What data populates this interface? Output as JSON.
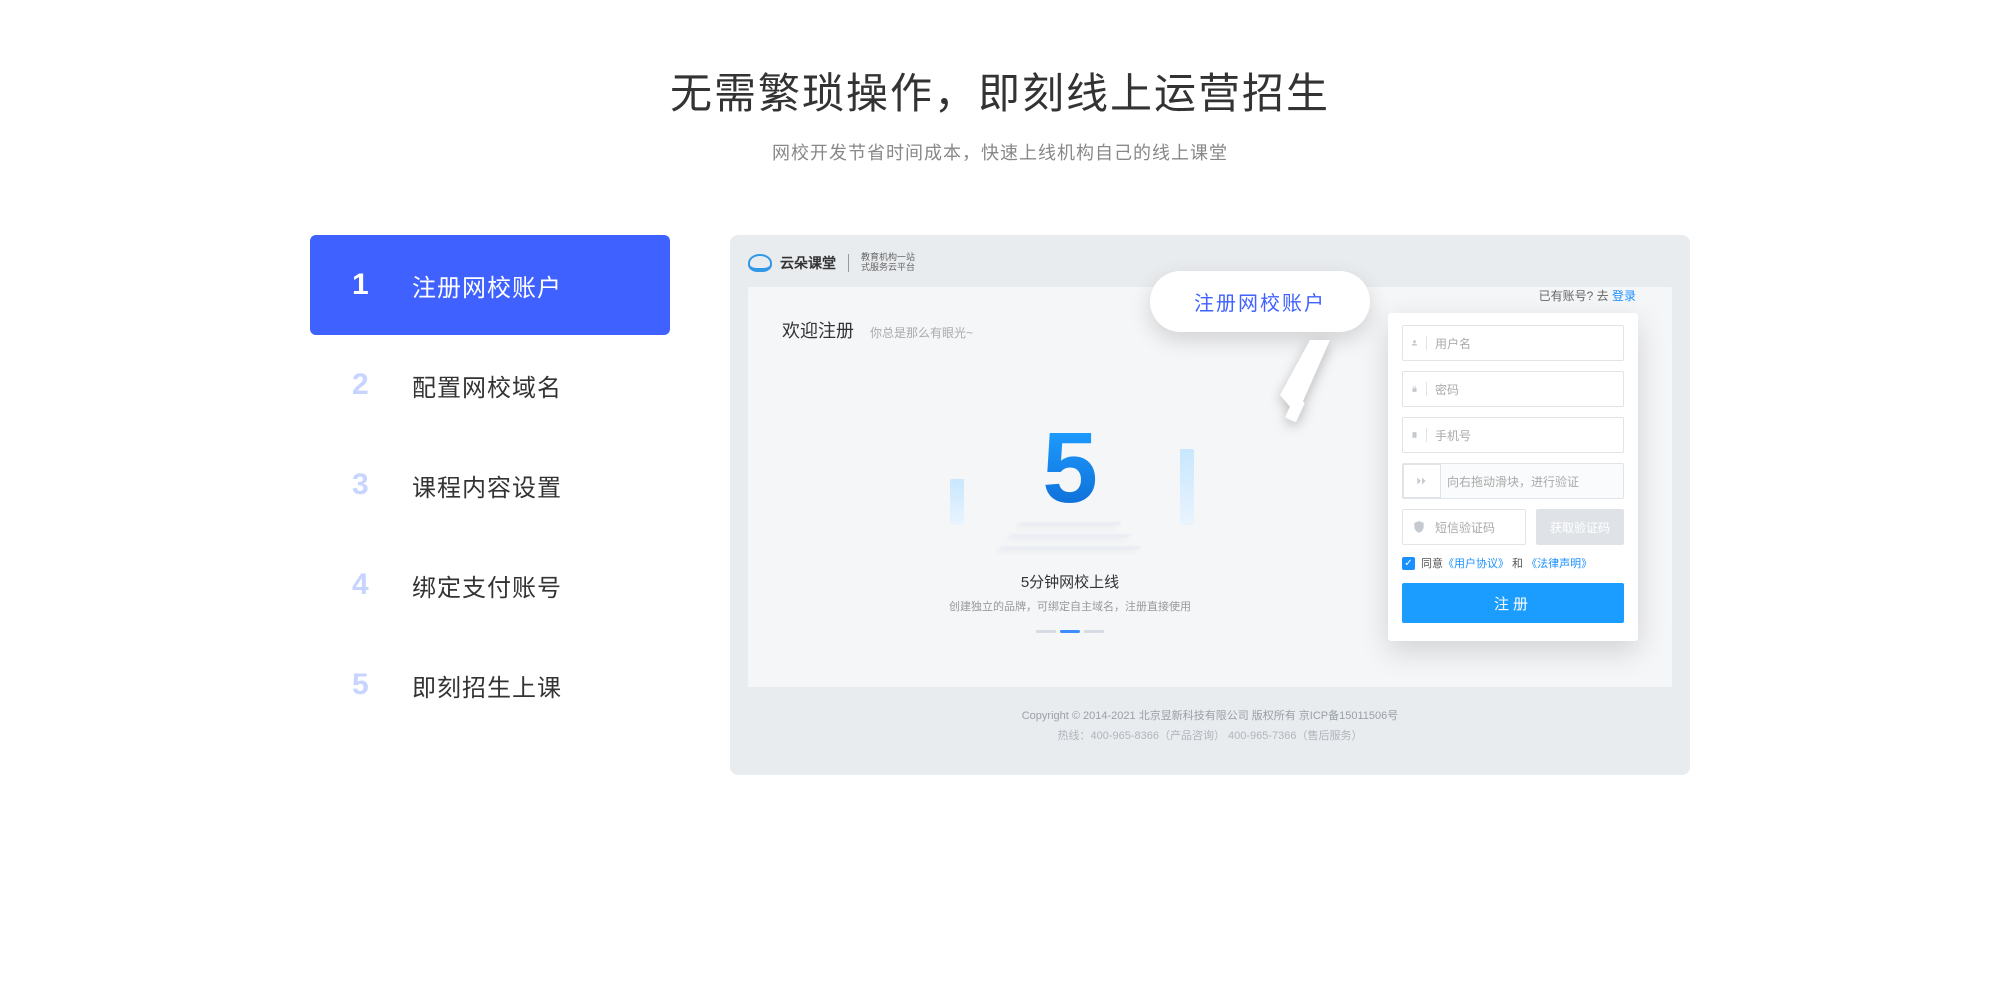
{
  "headline": {
    "title": "无需繁琐操作，即刻线上运营招生",
    "subtitle": "网校开发节省时间成本，快速上线机构自己的线上课堂"
  },
  "steps": [
    {
      "num": "1",
      "label": "注册网校账户",
      "active": true
    },
    {
      "num": "2",
      "label": "配置网校域名",
      "active": false
    },
    {
      "num": "3",
      "label": "课程内容设置",
      "active": false
    },
    {
      "num": "4",
      "label": "绑定支付账号",
      "active": false
    },
    {
      "num": "5",
      "label": "即刻招生上课",
      "active": false
    }
  ],
  "mock": {
    "brand": {
      "name": "云朵课堂",
      "sub1": "教育机构一站",
      "sub2": "式服务云平台"
    },
    "welcome_title": "欢迎注册",
    "welcome_sub": "你总是那么有眼光~",
    "center_big": "5",
    "center_line1": "5分钟网校上线",
    "center_line2": "创建独立的品牌，可绑定自主域名，注册直接使用",
    "login_hint_pre": "已有账号? 去 ",
    "login_hint_link": "登录",
    "fields": {
      "username": "用户名",
      "password": "密码",
      "phone": "手机号",
      "slider": "向右拖动滑块，进行验证",
      "smscode": "短信验证码",
      "getcode": "获取验证码"
    },
    "agree_pre": "同意",
    "agree_link1": "《用户协议》",
    "agree_mid": " 和 ",
    "agree_link2": "《法律声明》",
    "submit": "注册",
    "bubble": "注册网校账户",
    "footer_line1": "Copyright © 2014-2021 北京昱新科技有限公司 版权所有   京ICP备15011506号",
    "footer_line2": "热线：400-965-8366（产品咨询）  400-965-7366（售后服务）"
  }
}
